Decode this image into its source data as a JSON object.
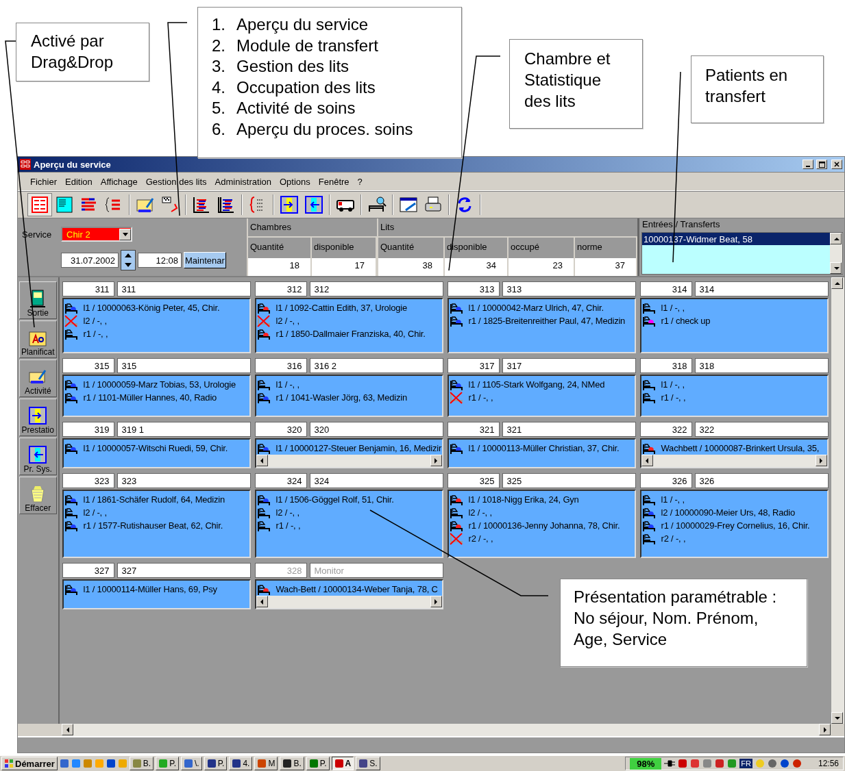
{
  "annotations": [
    {
      "kind": "note",
      "lines": [
        "Activé par",
        "Drag&Drop"
      ]
    },
    {
      "kind": "list",
      "items": [
        {
          "number": "1.",
          "text": "Aperçu du service"
        },
        {
          "number": "2.",
          "text": "Module de transfert"
        },
        {
          "number": "3.",
          "text": "Gestion des lits"
        },
        {
          "number": "4.",
          "text": "Occupation des lits"
        },
        {
          "number": "5.",
          "text": "Activité de soins"
        },
        {
          "number": "6.",
          "text": "Aperçu du proces. soins"
        }
      ]
    },
    {
      "kind": "note",
      "lines": [
        "Chambre et",
        "Statistique",
        "des lits"
      ]
    },
    {
      "kind": "note",
      "lines": [
        "Patients en",
        "transfert"
      ]
    },
    {
      "kind": "note",
      "lines": [
        "Présentation paramétrable :",
        "No séjour, Nom. Prénom,",
        "Age, Service"
      ]
    }
  ],
  "window": {
    "title": "Aperçu du service"
  },
  "menu": [
    "Fichier",
    "Edition",
    "Affichage",
    "Gestion des lits",
    "Administration",
    "Options",
    "Fenêtre",
    "?"
  ],
  "header": {
    "service_label": "Service",
    "service": "Chir 2",
    "date": "31.07.2002",
    "time": "12:08",
    "now_button": "Maintenar"
  },
  "stats": [
    {
      "title": "Chambres",
      "columns": [
        {
          "label": "Quantité",
          "value": "18"
        },
        {
          "label": "disponible",
          "value": "17"
        }
      ]
    },
    {
      "title": "Lits",
      "columns": [
        {
          "label": "Quantité",
          "value": "38"
        },
        {
          "label": "disponible",
          "value": "34"
        },
        {
          "label": "occupé",
          "value": "23"
        },
        {
          "label": "norme",
          "value": "37"
        }
      ]
    }
  ],
  "transfers": {
    "title": "Entrées / Transferts",
    "items": [
      {
        "text": "10000137-Widmer Beat, 58",
        "selected": true
      }
    ]
  },
  "sidebar": [
    "Sortie",
    "Planificat",
    "Activité",
    "Prestatio",
    "Pr. Sys.",
    "Effacer"
  ],
  "rooms": [
    {
      "number": "311",
      "name": "311",
      "disabled": false,
      "scroll": false,
      "beds": [
        {
          "kind": "occupied",
          "color": "#1e3cff",
          "text": "l1 / 10000063-König Peter, 45, Chir."
        },
        {
          "kind": "blocked",
          "text": "l2 / -, ,"
        },
        {
          "kind": "free",
          "text": "r1 / -, ,"
        }
      ]
    },
    {
      "number": "312",
      "name": "312",
      "disabled": false,
      "scroll": false,
      "beds": [
        {
          "kind": "occupied",
          "color": "#ff2020",
          "text": "l1 / 1092-Cattin Edith, 37, Urologie"
        },
        {
          "kind": "blocked",
          "text": "l2 / -, ,"
        },
        {
          "kind": "occupied",
          "color": "#ff2020",
          "text": "r1 / 1850-Dallmaier Franziska, 40, Chir."
        }
      ]
    },
    {
      "number": "313",
      "name": "313",
      "disabled": false,
      "scroll": false,
      "beds": [
        {
          "kind": "occupied",
          "color": "#1e3cff",
          "text": "l1 / 10000042-Marz Ulrich, 47, Chir."
        },
        {
          "kind": "occupied",
          "color": "#1e3cff",
          "text": "r1 / 1825-Breitenreither Paul, 47, Medizin"
        }
      ]
    },
    {
      "number": "314",
      "name": "314",
      "disabled": false,
      "scroll": false,
      "beds": [
        {
          "kind": "free",
          "text": "l1 / -, ,"
        },
        {
          "kind": "occupied",
          "color": "#ff00ff",
          "text": "r1 / check up"
        }
      ]
    },
    {
      "number": "315",
      "name": "315",
      "disabled": false,
      "scroll": false,
      "beds": [
        {
          "kind": "occupied",
          "color": "#1e3cff",
          "text": "l1 / 10000059-Marz Tobias, 53, Urologie"
        },
        {
          "kind": "occupied",
          "color": "#1e3cff",
          "text": "r1 / 1101-Müller Hannes, 40, Radio"
        }
      ]
    },
    {
      "number": "316",
      "name": "316 2",
      "disabled": false,
      "scroll": false,
      "beds": [
        {
          "kind": "free",
          "text": "l1 / -, ,"
        },
        {
          "kind": "occupied",
          "color": "#1e3cff",
          "text": "r1 / 1041-Wasler Jörg, 63, Medizin"
        }
      ]
    },
    {
      "number": "317",
      "name": "317",
      "disabled": false,
      "scroll": false,
      "beds": [
        {
          "kind": "occupied",
          "color": "#1e3cff",
          "text": "l1 / 1105-Stark Wolfgang, 24, NMed"
        },
        {
          "kind": "blocked",
          "text": "r1 / -, ,"
        }
      ]
    },
    {
      "number": "318",
      "name": "318",
      "disabled": false,
      "scroll": false,
      "beds": [
        {
          "kind": "free",
          "text": "l1 / -, ,"
        },
        {
          "kind": "free",
          "text": "r1 / -, ,"
        }
      ]
    },
    {
      "number": "319",
      "name": "319 1",
      "disabled": false,
      "scroll": false,
      "beds": [
        {
          "kind": "occupied",
          "color": "#1e3cff",
          "text": "l1 / 10000057-Witschi Ruedi, 59, Chir."
        }
      ]
    },
    {
      "number": "320",
      "name": "320",
      "disabled": false,
      "scroll": true,
      "beds": [
        {
          "kind": "occupied",
          "color": "#1e3cff",
          "text": "l1 / 10000127-Steuer Benjamin, 16, Medizir"
        }
      ]
    },
    {
      "number": "321",
      "name": "321",
      "disabled": false,
      "scroll": false,
      "beds": [
        {
          "kind": "occupied",
          "color": "#1e3cff",
          "text": "l1 / 10000113-Müller Christian, 37, Chir."
        }
      ]
    },
    {
      "number": "322",
      "name": "322",
      "disabled": false,
      "scroll": true,
      "beds": [
        {
          "kind": "occupied",
          "color": "#ff2020",
          "text": "Wachbett / 10000087-Brinkert Ursula, 35,"
        }
      ]
    },
    {
      "number": "323",
      "name": "323",
      "disabled": false,
      "scroll": false,
      "beds": [
        {
          "kind": "occupied",
          "color": "#1e3cff",
          "text": "l1 / 1861-Schäfer Rudolf, 64, Medizin"
        },
        {
          "kind": "free",
          "text": "l2 / -, ,"
        },
        {
          "kind": "occupied",
          "color": "#1e3cff",
          "text": "r1 / 1577-Rutishauser Beat, 62, Chir."
        }
      ]
    },
    {
      "number": "324",
      "name": "324",
      "disabled": false,
      "scroll": false,
      "beds": [
        {
          "kind": "occupied",
          "color": "#1e3cff",
          "text": "l1 / 1506-Göggel Rolf, 51, Chir."
        },
        {
          "kind": "free",
          "text": "l2 / -, ,"
        },
        {
          "kind": "free",
          "text": "r1 / -, ,"
        }
      ]
    },
    {
      "number": "325",
      "name": "325",
      "disabled": false,
      "scroll": false,
      "beds": [
        {
          "kind": "occupied",
          "color": "#ff2020",
          "text": "l1 / 1018-Nigg Erika, 24, Gyn"
        },
        {
          "kind": "free",
          "text": "l2 / -, ,"
        },
        {
          "kind": "occupied",
          "color": "#ff2020",
          "text": "r1 / 10000136-Jenny Johanna, 78, Chir."
        },
        {
          "kind": "blocked",
          "text": "r2 / -, ,"
        }
      ]
    },
    {
      "number": "326",
      "name": "326",
      "disabled": false,
      "scroll": false,
      "beds": [
        {
          "kind": "free",
          "text": "l1 / -, ,"
        },
        {
          "kind": "occupied",
          "color": "#1e3cff",
          "text": "l2 / 10000090-Meier Urs, 48, Radio"
        },
        {
          "kind": "occupied",
          "color": "#1e3cff",
          "text": "r1 / 10000029-Frey Cornelius, 16, Chir."
        },
        {
          "kind": "free",
          "text": "r2 / -, ,"
        }
      ]
    },
    {
      "number": "327",
      "name": "327",
      "disabled": false,
      "scroll": false,
      "beds": [
        {
          "kind": "occupied",
          "color": "#1e3cff",
          "text": "l1 / 10000114-Müller Hans, 69, Psy"
        }
      ]
    },
    {
      "number": "328",
      "name": "Monitor",
      "disabled": true,
      "scroll": true,
      "beds": [
        {
          "kind": "occupied",
          "color": "#ff2020",
          "text": "Wach-Bett / 10000134-Weber Tanja, 78, C"
        }
      ]
    }
  ],
  "taskbar": {
    "start": "Démarrer",
    "tasks": [
      {
        "label": "B.",
        "selected": false
      },
      {
        "label": "P.",
        "selected": false
      },
      {
        "label": "\\.",
        "selected": false
      },
      {
        "label": "P.",
        "selected": false
      },
      {
        "label": "4.",
        "selected": false
      },
      {
        "label": "M",
        "selected": false
      },
      {
        "label": "B.",
        "selected": false
      },
      {
        "label": "P.",
        "selected": false
      },
      {
        "label": "A",
        "selected": true
      },
      {
        "label": "S.",
        "selected": false
      }
    ],
    "battery": "98%",
    "language": "FR",
    "clock": "12:56"
  }
}
